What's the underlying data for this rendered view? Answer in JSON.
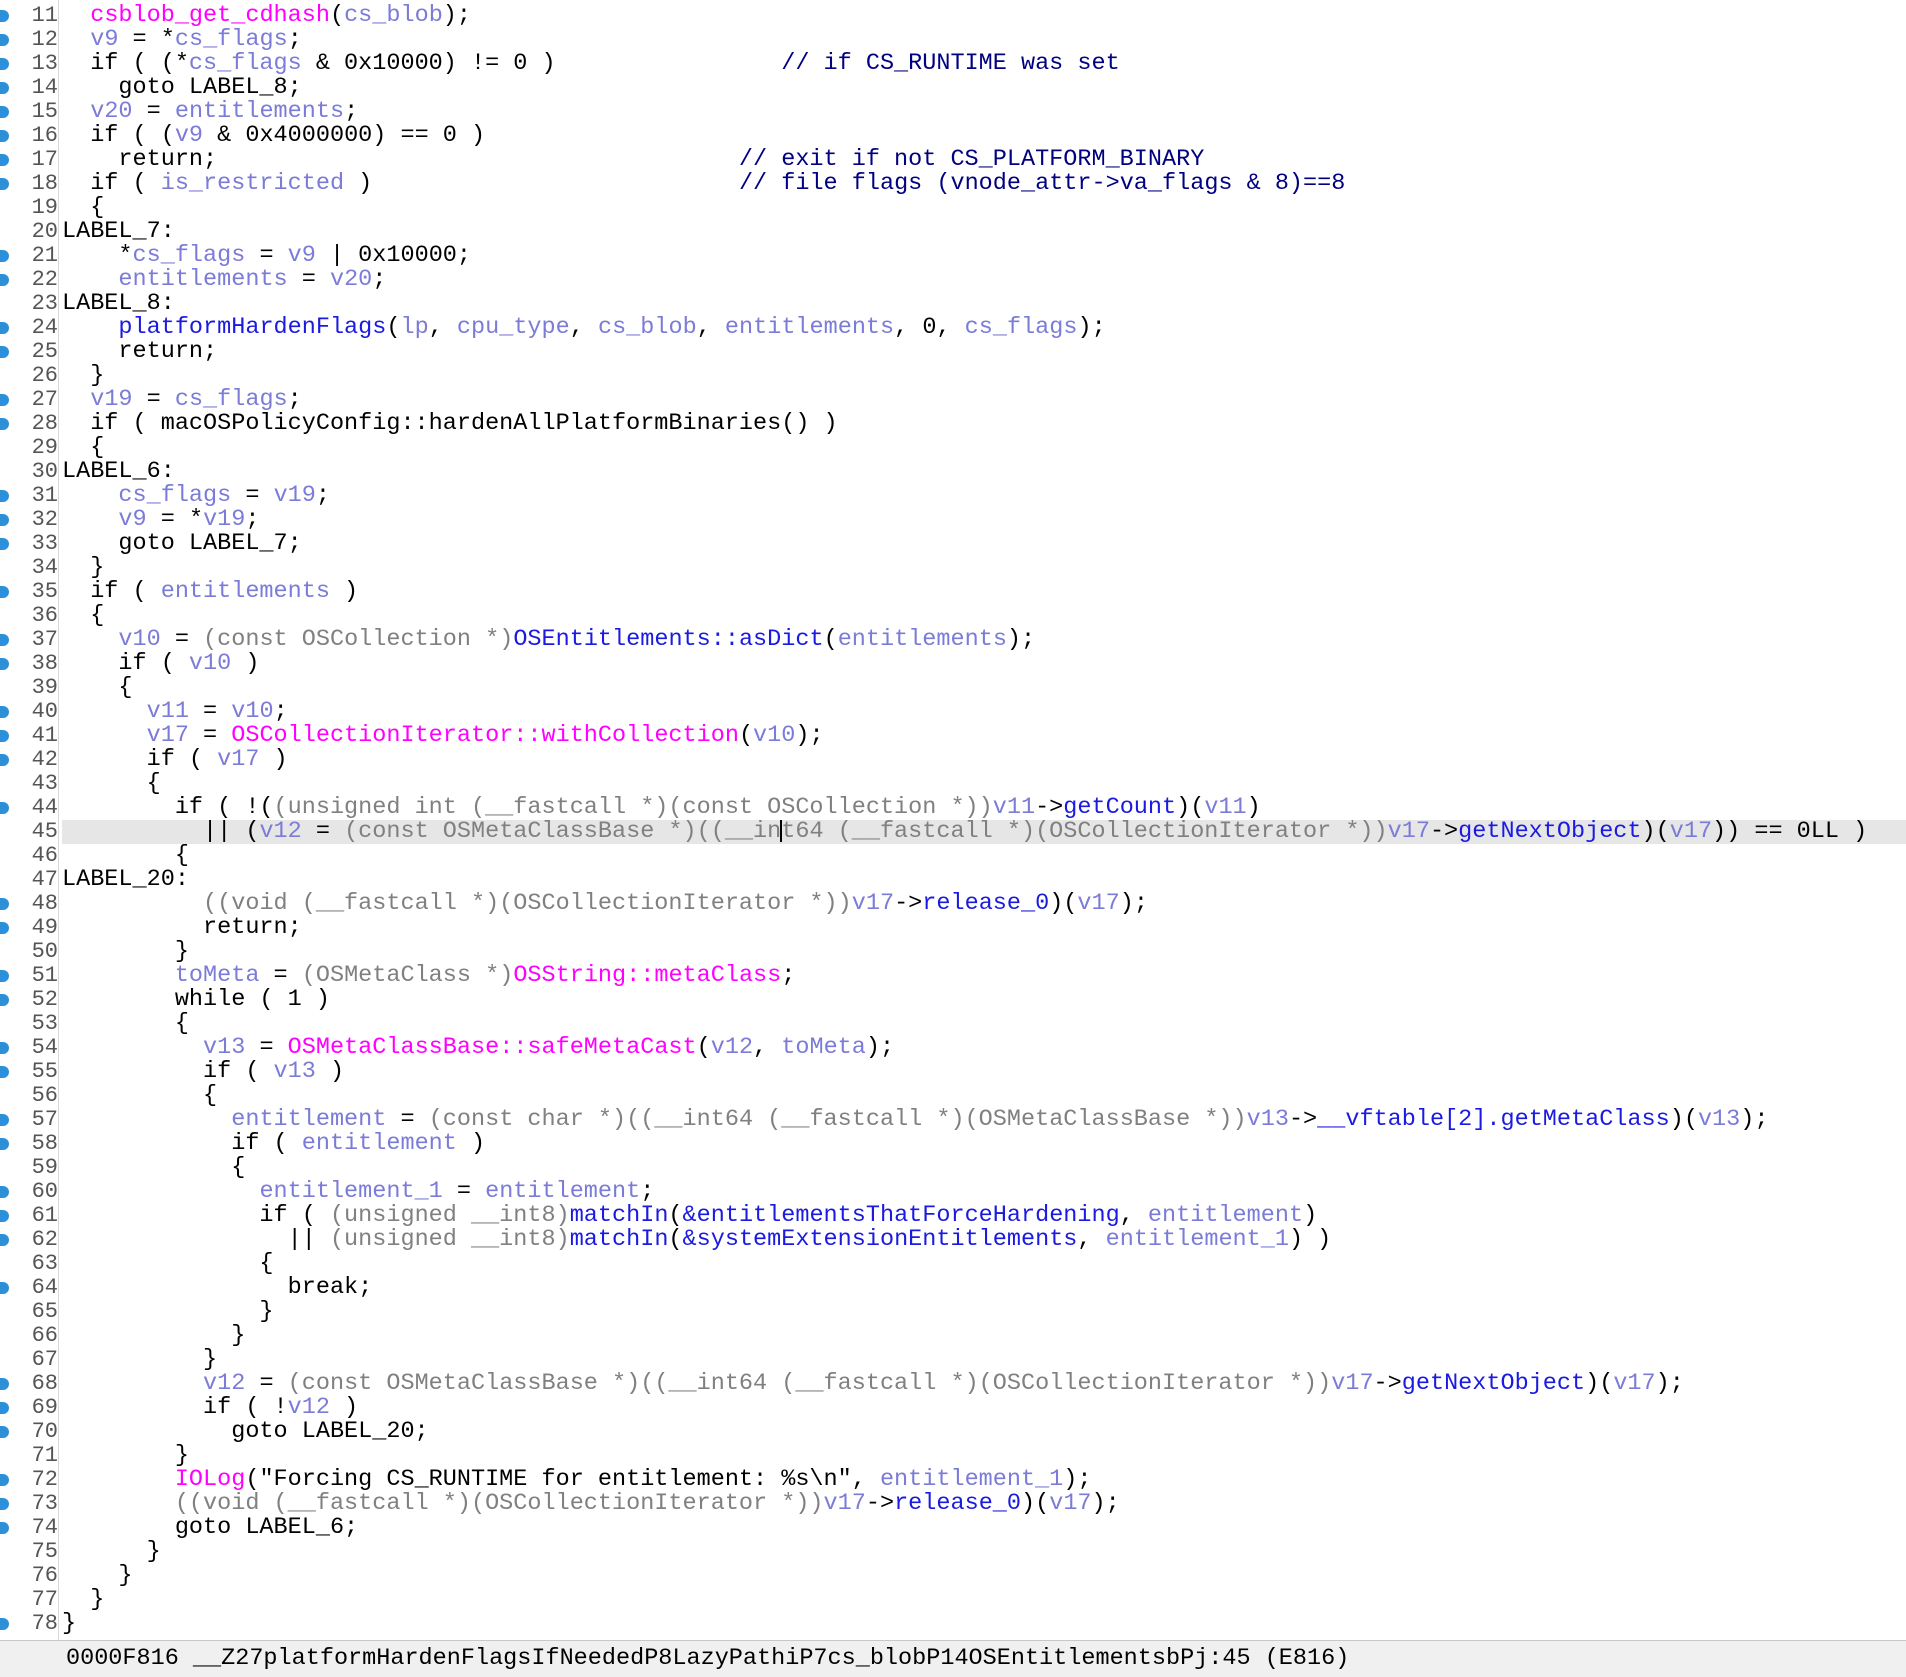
{
  "code_lines": [
    {
      "num": "11",
      "bp": true,
      "html": "  <span class=\"m\">csblob_get_cdhash</span>(<span class=\"v\">cs_blob</span>);"
    },
    {
      "num": "12",
      "bp": true,
      "html": "  <span class=\"v\">v9</span> = *<span class=\"v\">cs_flags</span>;"
    },
    {
      "num": "13",
      "bp": true,
      "html": "  if ( (*<span class=\"v\">cs_flags</span> &amp; 0x10000) != 0 )                <span class=\"c\">// if CS_RUNTIME was set</span>"
    },
    {
      "num": "14",
      "bp": true,
      "html": "    goto LABEL_8;"
    },
    {
      "num": "15",
      "bp": true,
      "html": "  <span class=\"v\">v20</span> = <span class=\"v\">entitlements</span>;"
    },
    {
      "num": "16",
      "bp": true,
      "html": "  if ( (<span class=\"v\">v9</span> &amp; 0x4000000) == 0 )"
    },
    {
      "num": "17",
      "bp": true,
      "html": "    return;                                     <span class=\"c\">// exit if not CS_PLATFORM_BINARY</span>"
    },
    {
      "num": "18",
      "bp": true,
      "html": "  if ( <span class=\"v\">is_restricted</span> )                          <span class=\"c\">// file flags (vnode_attr-&gt;va_flags &amp; 8)==8</span>"
    },
    {
      "num": "19",
      "bp": false,
      "html": "  {"
    },
    {
      "num": "20",
      "bp": false,
      "html": "LABEL_7:"
    },
    {
      "num": "21",
      "bp": true,
      "html": "    *<span class=\"v\">cs_flags</span> = <span class=\"v\">v9</span> | 0x10000;"
    },
    {
      "num": "22",
      "bp": true,
      "html": "    <span class=\"v\">entitlements</span> = <span class=\"v\">v20</span>;"
    },
    {
      "num": "23",
      "bp": false,
      "html": "LABEL_8:"
    },
    {
      "num": "24",
      "bp": true,
      "html": "    <span class=\"f\">platformHardenFlags</span>(<span class=\"v\">lp</span>, <span class=\"v\">cpu_type</span>, <span class=\"v\">cs_blob</span>, <span class=\"v\">entitlements</span>, 0, <span class=\"v\">cs_flags</span>);"
    },
    {
      "num": "25",
      "bp": true,
      "html": "    return;"
    },
    {
      "num": "26",
      "bp": false,
      "html": "  }"
    },
    {
      "num": "27",
      "bp": true,
      "html": "  <span class=\"v\">v19</span> = <span class=\"v\">cs_flags</span>;"
    },
    {
      "num": "28",
      "bp": true,
      "html": "  if ( macOSPolicyConfig::hardenAllPlatformBinaries() )"
    },
    {
      "num": "29",
      "bp": false,
      "html": "  {"
    },
    {
      "num": "30",
      "bp": false,
      "html": "LABEL_6:"
    },
    {
      "num": "31",
      "bp": true,
      "html": "    <span class=\"v\">cs_flags</span> = <span class=\"v\">v19</span>;"
    },
    {
      "num": "32",
      "bp": true,
      "html": "    <span class=\"v\">v9</span> = *<span class=\"v\">v19</span>;"
    },
    {
      "num": "33",
      "bp": true,
      "html": "    goto LABEL_7;"
    },
    {
      "num": "34",
      "bp": false,
      "html": "  }"
    },
    {
      "num": "35",
      "bp": true,
      "html": "  if ( <span class=\"v\">entitlements</span> )"
    },
    {
      "num": "36",
      "bp": false,
      "html": "  {"
    },
    {
      "num": "37",
      "bp": true,
      "html": "    <span class=\"v\">v10</span> = <span class=\"t\">(const OSCollection *)</span><span class=\"f\">OSEntitlements::asDict</span>(<span class=\"v\">entitlements</span>);"
    },
    {
      "num": "38",
      "bp": true,
      "html": "    if ( <span class=\"v\">v10</span> )"
    },
    {
      "num": "39",
      "bp": false,
      "html": "    {"
    },
    {
      "num": "40",
      "bp": true,
      "html": "      <span class=\"v\">v11</span> = <span class=\"v\">v10</span>;"
    },
    {
      "num": "41",
      "bp": true,
      "html": "      <span class=\"v\">v17</span> = <span class=\"m\">OSCollectionIterator::withCollection</span>(<span class=\"v\">v10</span>);"
    },
    {
      "num": "42",
      "bp": true,
      "html": "      if ( <span class=\"v\">v17</span> )"
    },
    {
      "num": "43",
      "bp": false,
      "html": "      {"
    },
    {
      "num": "44",
      "bp": true,
      "html": "        if ( !(<span class=\"t\">(unsigned int (__fastcall *)(const OSCollection *))</span><span class=\"v\">v11</span>-&gt;<span class=\"f\">getCount</span>)(<span class=\"v\">v11</span>)"
    },
    {
      "num": "45",
      "bp": false,
      "cur": true,
      "html": "          || (<span class=\"v\">v12</span> = <span class=\"t\">(const OSMetaClassBase *)((__in</span><span class=\"caret\" data-name=\"text-cursor\" data-interactable=\"false\"></span><span class=\"t\">t64 (__fastcall *)(OSCollectionIterator *))</span><span class=\"v\">v17</span>-&gt;<span class=\"f\">getNextObject</span>)(<span class=\"v\">v17</span>)) == 0LL )"
    },
    {
      "num": "46",
      "bp": false,
      "html": "        {"
    },
    {
      "num": "47",
      "bp": false,
      "html": "LABEL_20:"
    },
    {
      "num": "48",
      "bp": true,
      "html": "          <span class=\"t\">((void (__fastcall *)(OSCollectionIterator *))</span><span class=\"v\">v17</span>-&gt;<span class=\"f\">release_0</span>)(<span class=\"v\">v17</span>);"
    },
    {
      "num": "49",
      "bp": true,
      "html": "          return;"
    },
    {
      "num": "50",
      "bp": false,
      "html": "        }"
    },
    {
      "num": "51",
      "bp": true,
      "html": "        <span class=\"v\">toMeta</span> = <span class=\"t\">(OSMetaClass *)</span><span class=\"m\">OSString::metaClass</span>;"
    },
    {
      "num": "52",
      "bp": true,
      "html": "        while ( 1 )"
    },
    {
      "num": "53",
      "bp": false,
      "html": "        {"
    },
    {
      "num": "54",
      "bp": true,
      "html": "          <span class=\"v\">v13</span> = <span class=\"m\">OSMetaClassBase::safeMetaCast</span>(<span class=\"v\">v12</span>, <span class=\"v\">toMeta</span>);"
    },
    {
      "num": "55",
      "bp": true,
      "html": "          if ( <span class=\"v\">v13</span> )"
    },
    {
      "num": "56",
      "bp": false,
      "html": "          {"
    },
    {
      "num": "57",
      "bp": true,
      "html": "            <span class=\"v\">entitlement</span> = <span class=\"t\">(const char *)((__int64 (__fastcall *)(OSMetaClassBase *))</span><span class=\"v\">v13</span>-&gt;<span class=\"f\">__vftable[2].getMetaClass</span>)(<span class=\"v\">v13</span>);"
    },
    {
      "num": "58",
      "bp": true,
      "html": "            if ( <span class=\"v\">entitlement</span> )"
    },
    {
      "num": "59",
      "bp": false,
      "html": "            {"
    },
    {
      "num": "60",
      "bp": true,
      "html": "              <span class=\"v\">entitlement_1</span> = <span class=\"v\">entitlement</span>;"
    },
    {
      "num": "61",
      "bp": true,
      "html": "              if ( <span class=\"t\">(unsigned __int8)</span><span class=\"f\">matchIn</span>(<span class=\"f\">&amp;entitlementsThatForceHardening</span>, <span class=\"v\">entitlement</span>)"
    },
    {
      "num": "62",
      "bp": true,
      "html": "                || <span class=\"t\">(unsigned __int8)</span><span class=\"f\">matchIn</span>(<span class=\"f\">&amp;systemExtensionEntitlements</span>, <span class=\"v\">entitlement_1</span>) )"
    },
    {
      "num": "63",
      "bp": false,
      "html": "              {"
    },
    {
      "num": "64",
      "bp": true,
      "html": "                break;"
    },
    {
      "num": "65",
      "bp": false,
      "html": "              }"
    },
    {
      "num": "66",
      "bp": false,
      "html": "            }"
    },
    {
      "num": "67",
      "bp": false,
      "html": "          }"
    },
    {
      "num": "68",
      "bp": true,
      "html": "          <span class=\"v\">v12</span> = <span class=\"t\">(const OSMetaClassBase *)((__int64 (__fastcall *)(OSCollectionIterator *))</span><span class=\"v\">v17</span>-&gt;<span class=\"f\">getNextObject</span>)(<span class=\"v\">v17</span>);"
    },
    {
      "num": "69",
      "bp": true,
      "html": "          if ( !<span class=\"v\">v12</span> )"
    },
    {
      "num": "70",
      "bp": true,
      "html": "            goto LABEL_20;"
    },
    {
      "num": "71",
      "bp": false,
      "html": "        }"
    },
    {
      "num": "72",
      "bp": true,
      "html": "        <span class=\"m\">IOLog</span>(\"Forcing CS_RUNTIME for entitlement: %s\\n\", <span class=\"v\">entitlement_1</span>);"
    },
    {
      "num": "73",
      "bp": true,
      "html": "        <span class=\"t\">((void (__fastcall *)(OSCollectionIterator *))</span><span class=\"v\">v17</span>-&gt;<span class=\"f\">release_0</span>)(<span class=\"v\">v17</span>);"
    },
    {
      "num": "74",
      "bp": true,
      "html": "        goto LABEL_6;"
    },
    {
      "num": "75",
      "bp": false,
      "html": "      }"
    },
    {
      "num": "76",
      "bp": false,
      "html": "    }"
    },
    {
      "num": "77",
      "bp": false,
      "html": "  }"
    },
    {
      "num": "78",
      "bp": true,
      "html": "}"
    }
  ],
  "statusbar": {
    "text": "0000F816 __Z27platformHardenFlagsIfNeededP8LazyPathiP7cs_blobP14OSEntitlementsbPj:45 (E816)"
  },
  "colors": {
    "variable": "#7b7bd8",
    "function": "#1a1ae0",
    "import": "#ff00ff",
    "type": "#808080",
    "comment": "#000080",
    "breakpoint": "#2d8fd8"
  }
}
